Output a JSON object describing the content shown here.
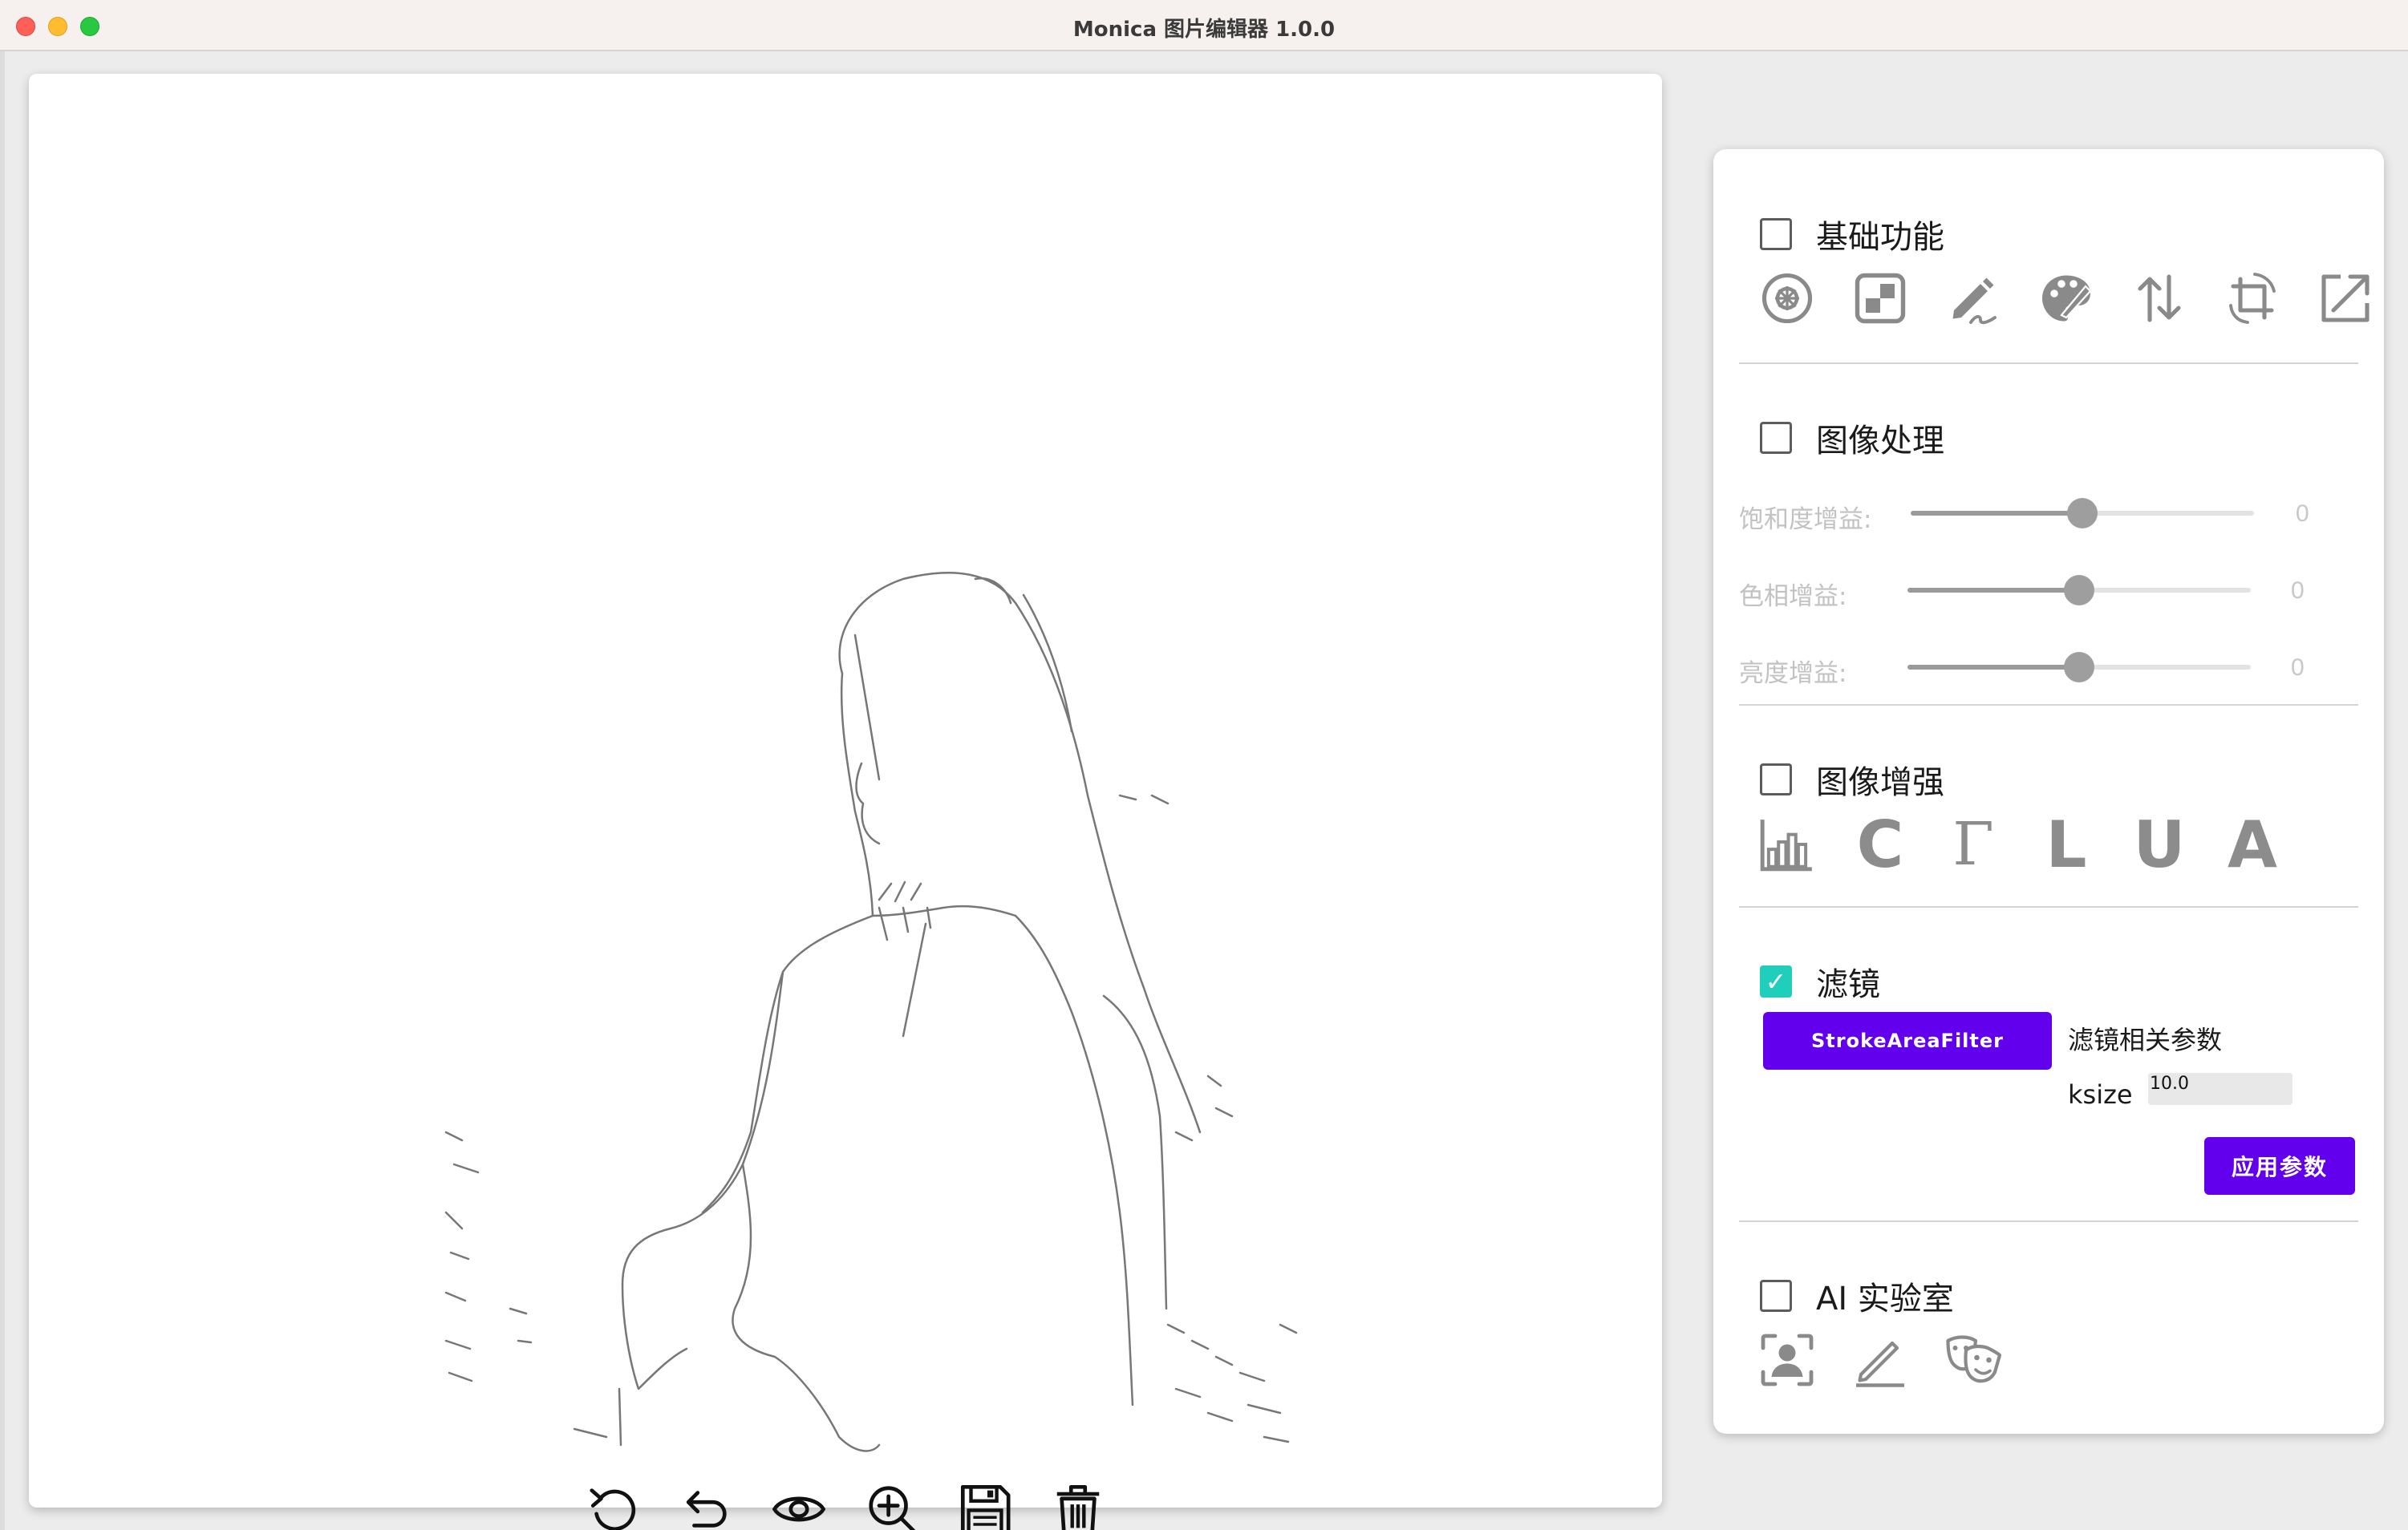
{
  "window": {
    "title": "Monica 图片编辑器 1.0.0",
    "traffic_lights": [
      "close",
      "minimize",
      "zoom"
    ],
    "colors": {
      "close": "#fe5f57",
      "minimize": "#febc2e",
      "zoom": "#28c840"
    }
  },
  "canvas": {
    "image_description_icon": "sketch-image",
    "toolbar": [
      {
        "name": "reset-icon"
      },
      {
        "name": "undo-icon"
      },
      {
        "name": "preview-eye-icon"
      },
      {
        "name": "zoom-in-icon"
      },
      {
        "name": "save-icon"
      },
      {
        "name": "delete-icon"
      }
    ]
  },
  "panel": {
    "basic": {
      "title": "基础功能",
      "checked": false,
      "icons": [
        "blur-circle-icon",
        "mosaic-icon",
        "draw-pen-icon",
        "color-palette-icon",
        "flip-icon",
        "crop-rotate-icon",
        "resize-icon"
      ]
    },
    "processing": {
      "title": "图像处理",
      "checked": false,
      "sliders": [
        {
          "label": "饱和度增益:",
          "value": "0",
          "position": 0.5
        },
        {
          "label": "色相增益:",
          "value": "0",
          "position": 0.5
        },
        {
          "label": "亮度增益:",
          "value": "0",
          "position": 0.5
        }
      ]
    },
    "enhance": {
      "title": "图像增强",
      "checked": false,
      "buttons": [
        "C",
        "Γ",
        "L",
        "U",
        "A"
      ],
      "first_icon": "histogram-icon"
    },
    "filter": {
      "title": "滤镜",
      "checked": true,
      "check_mark": "✓",
      "selected_filter": "StrokeAreaFilter",
      "params_title": "滤镜相关参数",
      "param_label": "ksize",
      "param_value": "10.0",
      "apply_label": "应用参数"
    },
    "ai": {
      "title": "AI 实验室",
      "checked": false,
      "icons": [
        "face-detect-icon",
        "sketch-pen-icon",
        "theater-masks-icon"
      ]
    },
    "accent": "#6200ee",
    "check_color": "#1fcfbb"
  }
}
